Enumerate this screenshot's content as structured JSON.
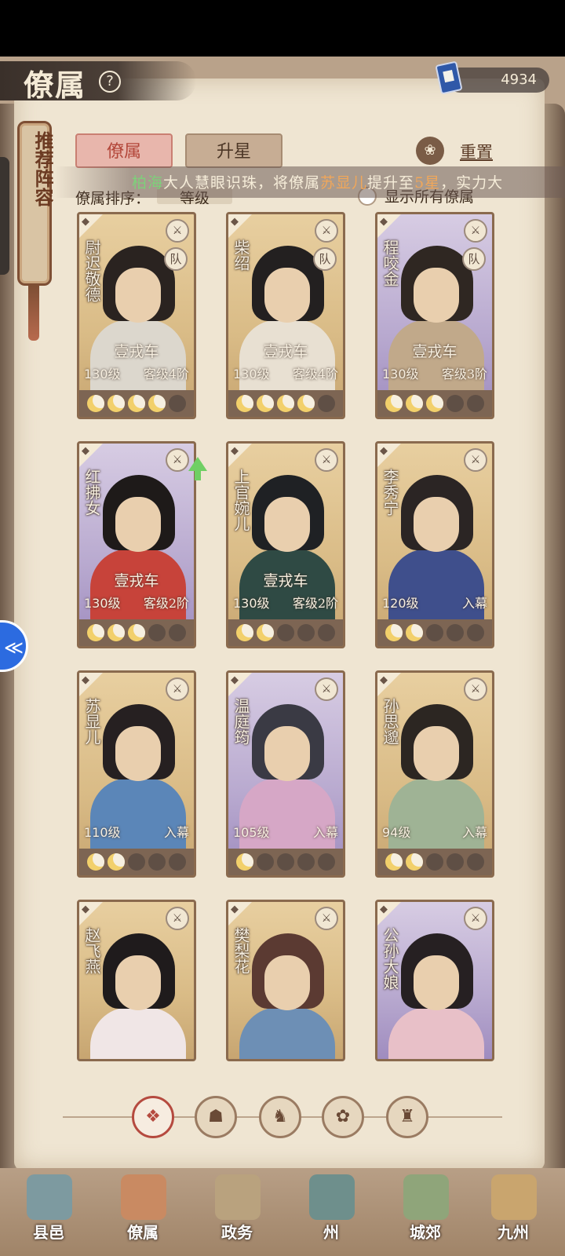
{
  "header": {
    "title": "僚属",
    "currency_value": "4934"
  },
  "recommend": {
    "label": "推荐阵容"
  },
  "tabs": [
    {
      "label": "僚属",
      "active": true
    },
    {
      "label": "升星",
      "active": false
    }
  ],
  "reset": {
    "label": "重置"
  },
  "announcement": {
    "player": "柏海",
    "text_1": "大人慧眼识珠，将僚属",
    "hero": "苏显儿",
    "text_2": "提升至",
    "stars": "5星",
    "text_3": "，实力大"
  },
  "sort": {
    "label": "僚属排序：",
    "value": "等级"
  },
  "show_all": {
    "label": "显示所有僚属"
  },
  "cards": [
    {
      "name": "尉迟敬德",
      "equip": "壹戎车",
      "level": "130级",
      "rank": "客级4阶",
      "stars": 4,
      "max_stars": 5,
      "badge": "队",
      "frame": "gold"
    },
    {
      "name": "柴绍",
      "equip": "壹戎车",
      "level": "130级",
      "rank": "客级4阶",
      "stars": 4,
      "max_stars": 5,
      "badge": "队",
      "frame": "gold"
    },
    {
      "name": "程咬金",
      "equip": "壹戎车",
      "level": "130级",
      "rank": "客级3阶",
      "stars": 3,
      "max_stars": 5,
      "badge": "队",
      "frame": "purple"
    },
    {
      "name": "红拂女",
      "equip": "壹戎车",
      "level": "130级",
      "rank": "客级2阶",
      "stars": 3,
      "max_stars": 5,
      "badge": "",
      "frame": "purple"
    },
    {
      "name": "上官婉儿",
      "equip": "壹戎车",
      "level": "130级",
      "rank": "客级2阶",
      "stars": 2,
      "max_stars": 5,
      "badge": "",
      "frame": "gold"
    },
    {
      "name": "李秀宁",
      "equip": "",
      "level": "120级",
      "rank": "入幕",
      "stars": 2,
      "max_stars": 5,
      "badge": "",
      "frame": "gold"
    },
    {
      "name": "苏显儿",
      "equip": "",
      "level": "110级",
      "rank": "入幕",
      "stars": 2,
      "max_stars": 5,
      "badge": "",
      "frame": "gold"
    },
    {
      "name": "温庭筠",
      "equip": "",
      "level": "105级",
      "rank": "入幕",
      "stars": 1,
      "max_stars": 5,
      "badge": "",
      "frame": "purple"
    },
    {
      "name": "孙思邈",
      "equip": "",
      "level": "94级",
      "rank": "入幕",
      "stars": 2,
      "max_stars": 5,
      "badge": "",
      "frame": "gold"
    },
    {
      "name": "赵飞燕",
      "equip": "",
      "level": "",
      "rank": "",
      "stars": 0,
      "max_stars": 5,
      "badge": "",
      "frame": "gold"
    },
    {
      "name": "樊梨花",
      "equip": "",
      "level": "",
      "rank": "",
      "stars": 0,
      "max_stars": 5,
      "badge": "",
      "frame": "gold"
    },
    {
      "name": "公孙大娘",
      "equip": "",
      "level": "",
      "rank": "",
      "stars": 0,
      "max_stars": 5,
      "badge": "",
      "frame": "purple"
    }
  ],
  "filters": [
    "all-filter-icon",
    "filter-2-icon",
    "filter-3-icon",
    "filter-4-icon",
    "filter-5-icon"
  ],
  "bottom_nav": [
    {
      "label": "县邑",
      "active": false
    },
    {
      "label": "僚属",
      "active": true
    },
    {
      "label": "政务",
      "active": false
    },
    {
      "label": "州",
      "active": false
    },
    {
      "label": "城郊",
      "active": false
    },
    {
      "label": "九州",
      "active": false
    }
  ],
  "colors": {
    "frame_gold": "#d9bb86",
    "frame_purple": "#b8a9cf",
    "accent_red": "#b54a3f",
    "star_on": "#f2d06b"
  }
}
